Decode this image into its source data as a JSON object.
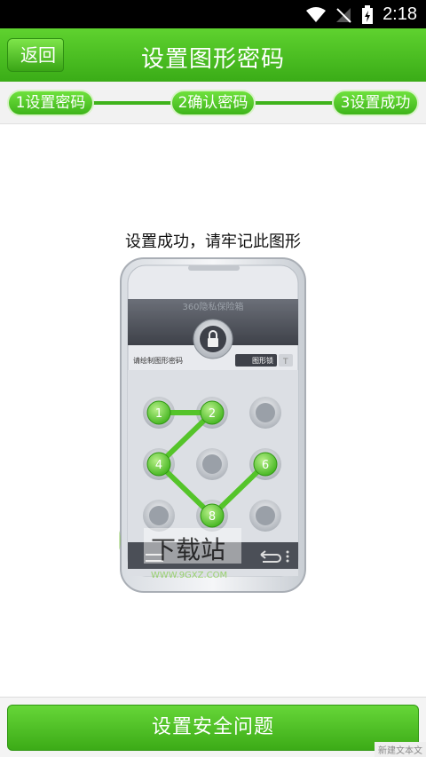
{
  "status": {
    "time": "2:18"
  },
  "header": {
    "back": "返回",
    "title": "设置图形密码"
  },
  "steps": [
    {
      "label": "1设置密码"
    },
    {
      "label": "2确认密码"
    },
    {
      "label": "3设置成功"
    }
  ],
  "main": {
    "instruction": "设置成功，请牢记此图形"
  },
  "phone_image": {
    "app_name": "360隐私保险箱",
    "prompt": "请绘制图形密码",
    "mode_label": "图形锁",
    "text_mode_glyph": "T",
    "keypad": [
      "1",
      "2",
      "",
      "4",
      "",
      "6",
      "",
      "8",
      ""
    ],
    "pattern": [
      "1",
      "2",
      "4",
      "8",
      "6"
    ]
  },
  "watermark": {
    "text": "下载站",
    "url": "WWW.9GXZ.COM"
  },
  "footer": {
    "button": "设置安全问题",
    "tag": "新建文本文"
  }
}
